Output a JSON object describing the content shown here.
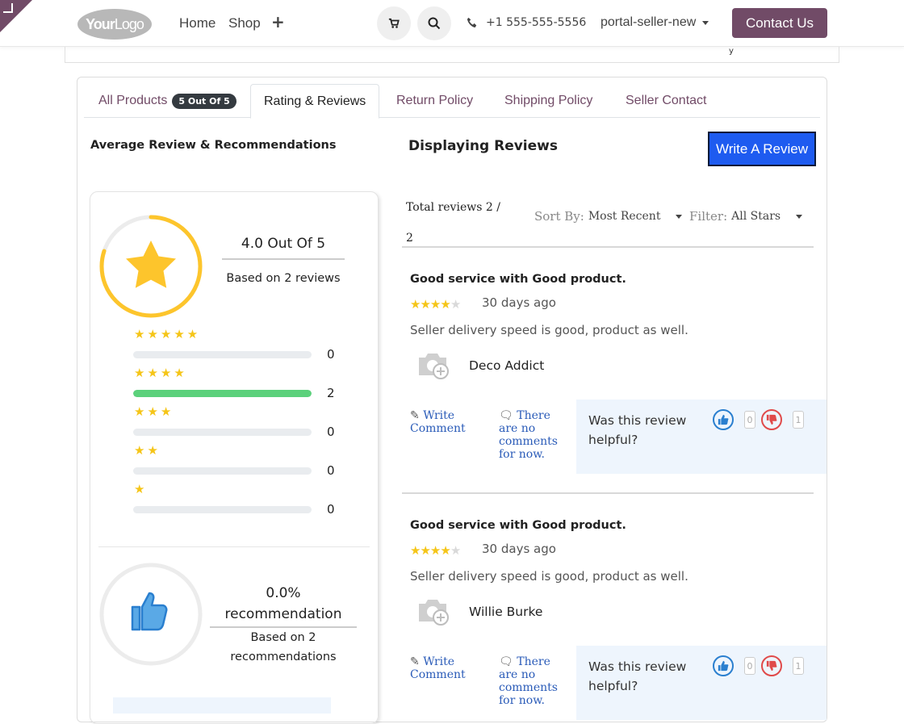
{
  "header": {
    "logo_text_bold": "Your",
    "logo_text_light": "Logo",
    "nav": [
      "Home",
      "Shop"
    ],
    "phone": "+1 555-555-5556",
    "user": "portal-seller-new",
    "contact_label": "Contact Us"
  },
  "tabs": [
    {
      "label": "All Products",
      "badge": "5 Out Of 5"
    },
    {
      "label": "Rating & Reviews"
    },
    {
      "label": "Return Policy"
    },
    {
      "label": "Shipping Policy"
    },
    {
      "label": "Seller Contact"
    }
  ],
  "summary": {
    "heading": "Average Review & Recommendations",
    "score": "4.0 Out Of 5",
    "score_fraction": 0.8,
    "based": "Based on 2 reviews",
    "breakdown": [
      {
        "stars": "★★★★★",
        "count": "0",
        "fraction": 0
      },
      {
        "stars": "★★★★",
        "count": "2",
        "fraction": 1
      },
      {
        "stars": "★★★",
        "count": "0",
        "fraction": 0
      },
      {
        "stars": "★★",
        "count": "0",
        "fraction": 0
      },
      {
        "stars": "★",
        "count": "0",
        "fraction": 0
      }
    ],
    "recommendation": "0.0% recommendation",
    "rec_based": "Based on 2 recommendations"
  },
  "reviews_panel": {
    "heading": "Displaying Reviews",
    "write_review": "Write A Review",
    "total": "Total reviews 2 / 2",
    "sort_label": "Sort By:",
    "sort_value": "Most Recent",
    "filter_label": "Filter:",
    "filter_value": "All Stars"
  },
  "reviews": [
    {
      "title": "Good service with Good product.",
      "rating": 4,
      "date": "30 days ago",
      "body": "Seller delivery speed is good, product as well.",
      "author": "Deco Addict",
      "write_comment": "Write Comment",
      "no_comments": "There are no comments for now.",
      "helpful_q": "Was this review helpful?",
      "up_count": "0",
      "down_count": "1"
    },
    {
      "title": "Good service with Good product.",
      "rating": 4,
      "date": "30 days ago",
      "body": "Seller delivery speed is good, product as well.",
      "author": "Willie Burke",
      "write_comment": "Write Comment",
      "no_comments": "There are no comments for now.",
      "helpful_q": "Was this review helpful?",
      "up_count": "0",
      "down_count": "1"
    }
  ],
  "colors": {
    "brand": "#714b67",
    "primary_button": "#1e5bf0",
    "star": "#f5c518",
    "bar_fill": "#5bd17b",
    "link": "#2a5bb8"
  }
}
